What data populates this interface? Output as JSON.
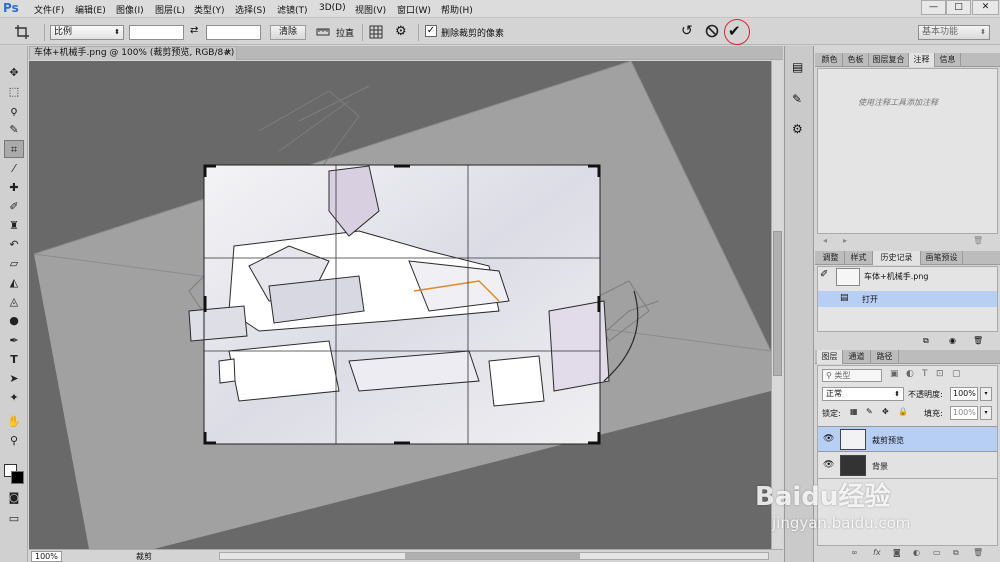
{
  "app": {
    "logo": "Ps"
  },
  "menu": [
    "文件(F)",
    "编辑(E)",
    "图像(I)",
    "图层(L)",
    "类型(Y)",
    "选择(S)",
    "滤镜(T)",
    "3D(D)",
    "视图(V)",
    "窗口(W)",
    "帮助(H)"
  ],
  "window_controls": {
    "minimize": "—",
    "restore": "□",
    "close": "✕"
  },
  "options": {
    "ratio_select": "比例",
    "width_value": "",
    "swap_icon": "⇄",
    "height_value": "",
    "clear_button": "清除",
    "straighten_label": "拉直",
    "delete_pixels_label": "删除裁剪的像素",
    "delete_pixels_checked": true,
    "workspace": "基本功能"
  },
  "document": {
    "tab_title": "车体+机械手.png @ 100% (裁剪预览, RGB/8#)",
    "zoom": "100%",
    "status_tool": "裁剪"
  },
  "notes_panel": {
    "tabs": [
      "颜色",
      "色板",
      "图层复合",
      "注释",
      "信息"
    ],
    "active_tab": "注释",
    "hint": "使用注释工具添加注释"
  },
  "history_panel": {
    "tabs": [
      "调整",
      "样式",
      "历史记录",
      "画笔预设"
    ],
    "active_tab": "历史记录",
    "snapshot": "车体+机械手.png",
    "items": [
      "打开"
    ]
  },
  "layers_panel": {
    "tabs": [
      "图层",
      "通道",
      "路径"
    ],
    "active_tab": "图层",
    "kind_filter": "类型",
    "blend_mode": "正常",
    "opacity_label": "不透明度:",
    "opacity": "100%",
    "lock_label": "锁定:",
    "fill_label": "填充:",
    "fill": "100%",
    "layers": [
      {
        "name": "裁剪预览",
        "selected": true
      },
      {
        "name": "背景",
        "selected": false
      }
    ]
  },
  "watermark": {
    "brand": "Baidu经验",
    "url": "jingyan.baidu.com"
  },
  "colors": {
    "accent_circle": "#d9272e",
    "selection_blue": "#b8cff5",
    "canvas_bg": "#696969"
  }
}
